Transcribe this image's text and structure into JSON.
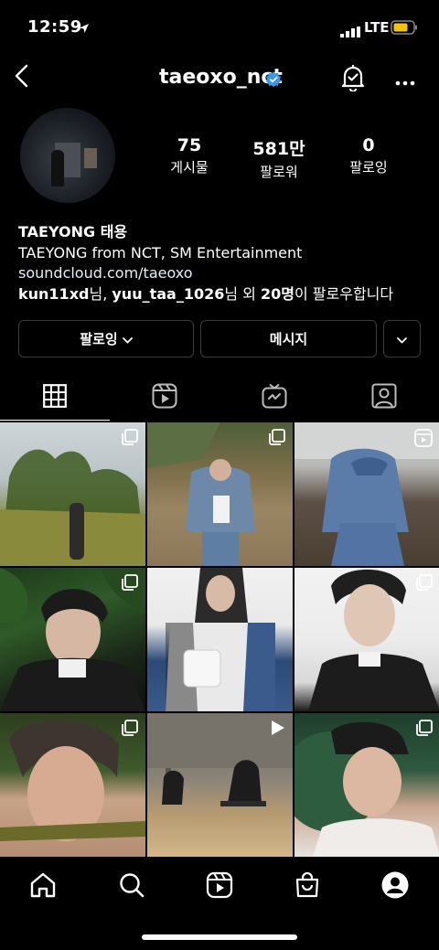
{
  "status_bar": {
    "time": "12:59",
    "network": "LTE",
    "battery_color": "#f4c30b"
  },
  "header": {
    "username": "taeoxo_nct",
    "verified_color": "#3897f0",
    "icons": [
      "back-icon",
      "verified-icon",
      "notification-bell-icon",
      "more-icon"
    ]
  },
  "stats": {
    "posts": {
      "value": "75",
      "label": "게시물"
    },
    "followers": {
      "value": "581만",
      "label": "팔로워"
    },
    "following": {
      "value": "0",
      "label": "팔로잉"
    }
  },
  "bio": {
    "name": "TAEYONG 태용",
    "description": "TAEYONG from NCT, SM Entertainment",
    "link": "soundcloud.com/taeoxo",
    "followed_by_user1": "kun11xd",
    "followed_by_sep1": "님, ",
    "followed_by_user2": "yuu_taa_1026",
    "followed_by_sep2": "님 외 ",
    "followed_by_count": "20명",
    "followed_by_suffix": "이 팔로우합니다"
  },
  "actions": {
    "following_label": "팔로잉",
    "message_label": "메시지"
  },
  "tabs": [
    "grid-icon",
    "reels-icon",
    "igtv-icon",
    "tagged-icon"
  ],
  "posts": [
    {
      "type": "multi"
    },
    {
      "type": "multi"
    },
    {
      "type": "reel"
    },
    {
      "type": "multi"
    },
    {
      "type": "image"
    },
    {
      "type": "multi"
    },
    {
      "type": "multi"
    },
    {
      "type": "video"
    },
    {
      "type": "multi"
    }
  ],
  "bottom_nav": [
    "home-icon",
    "search-icon",
    "reels-icon",
    "shop-icon",
    "profile-icon"
  ]
}
